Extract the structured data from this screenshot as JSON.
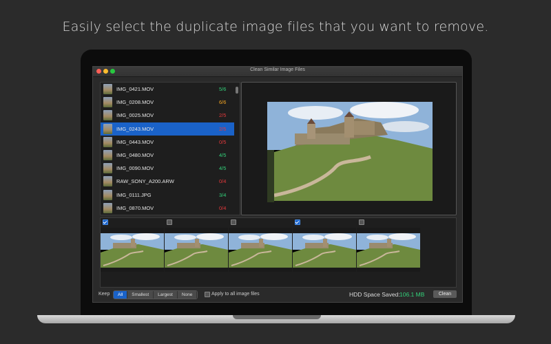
{
  "headline": "Easily select the duplicate image files that you want to remove.",
  "window": {
    "title": "Clean Similar Image Files"
  },
  "files": [
    {
      "name": "IMG_0421.MOV",
      "count": "5/6",
      "status": "green",
      "selected": false
    },
    {
      "name": "IMG_0208.MOV",
      "count": "6/6",
      "status": "orange",
      "selected": false
    },
    {
      "name": "IMG_0025.MOV",
      "count": "2/5",
      "status": "red",
      "selected": false
    },
    {
      "name": "IMG_0243.MOV",
      "count": "2/5",
      "status": "red",
      "selected": true
    },
    {
      "name": "IMG_0443.MOV",
      "count": "0/5",
      "status": "red",
      "selected": false
    },
    {
      "name": "IMG_0480.MOV",
      "count": "4/5",
      "status": "green",
      "selected": false
    },
    {
      "name": "IMG_0090.MOV",
      "count": "4/5",
      "status": "green",
      "selected": false
    },
    {
      "name": "RAW_SONY_A200.ARW",
      "count": "0/4",
      "status": "red",
      "selected": false
    },
    {
      "name": "IMG_0111.JPG",
      "count": "3/4",
      "status": "green",
      "selected": false
    },
    {
      "name": "IMG_0870.MOV",
      "count": "0/4",
      "status": "red",
      "selected": false
    }
  ],
  "thumbnails": [
    {
      "checked": true
    },
    {
      "checked": false
    },
    {
      "checked": false
    },
    {
      "checked": true
    },
    {
      "checked": false
    }
  ],
  "bottom": {
    "keep_label": "Keep",
    "keep_options": [
      "All",
      "Smallest",
      "Largest",
      "None"
    ],
    "keep_selected": "All",
    "apply_label": "Apply to all image files",
    "apply_checked": false,
    "hdd_label": "HDD Space Saved:",
    "hdd_value": "106.1 MB",
    "clean_label": "Clean"
  },
  "colors": {
    "green": "#33d17a",
    "orange": "#f5a623",
    "red": "#e5393c",
    "accent": "#1a62c8"
  }
}
